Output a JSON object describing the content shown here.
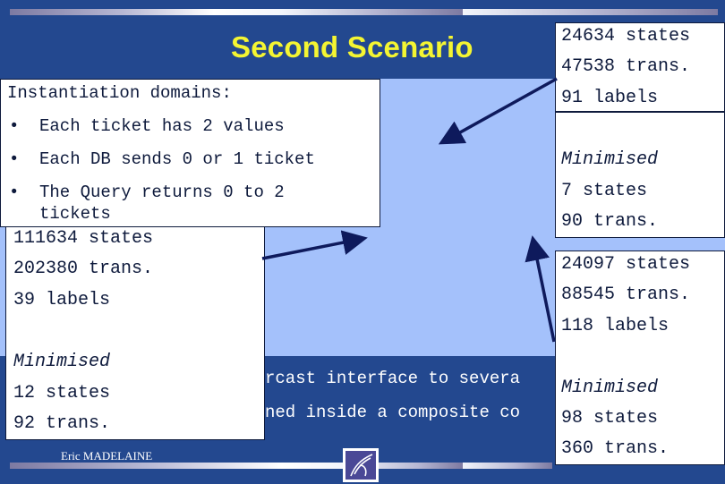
{
  "slide": {
    "title": "Second Scenario",
    "author": "Eric MADELAINE",
    "logo_icon": "inria-logo-icon",
    "body_lines": [
      "rcast interface to severa",
      "ned inside a composite co"
    ]
  },
  "domains_box": {
    "heading": "Instantiation domains:",
    "bullet_char": "•",
    "bullets": [
      "Each ticket has 2 values",
      "Each DB sends 0 or 1 ticket",
      "The Query returns 0 to 2",
      "tickets"
    ]
  },
  "box_left": {
    "states": "111634 states",
    "trans": "202380 trans.",
    "labels": "39 labels",
    "min_label": "Minimised",
    "min_states": "12 states",
    "min_trans": "92 trans."
  },
  "box_top_right": {
    "states": "24634 states",
    "trans": "47538 trans.",
    "labels": "91 labels"
  },
  "box_mid_right": {
    "min_label": "Minimised",
    "min_states": "7 states",
    "min_trans": "90 trans."
  },
  "box_bottom_right": {
    "states": "24097 states",
    "trans": "88545 trans.",
    "labels": "118 labels",
    "min_label": "Minimised",
    "min_states": "98 states",
    "min_trans": "360 trans."
  },
  "colors": {
    "background": "#23488f",
    "panel": "#a4c1fb",
    "title": "#f4f532",
    "arrow": "#0e1a5c"
  }
}
